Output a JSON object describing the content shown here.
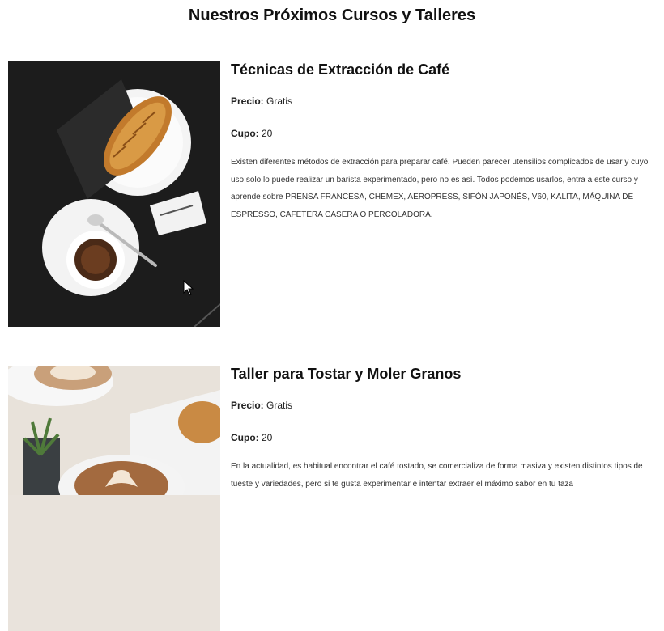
{
  "page": {
    "title": "Nuestros Próximos Cursos y Talleres"
  },
  "courses": [
    {
      "image_icon": "croissant-coffee-photo",
      "title": "Técnicas de Extracción de Café",
      "price_label": "Precio:",
      "price_value": "Gratis",
      "capacity_label": "Cupo:",
      "capacity_value": "20",
      "description": "Existen diferentes métodos de extracción para preparar café. Pueden parecer utensilios complicados de usar y cuyo uso solo lo puede realizar un barista experimentado, pero no es así. Todos podemos usarlos, entra a este curso y aprende sobre PRENSA FRANCESA, CHEMEX, AEROPRESS, SIFÓN JAPONÉS, V60, KALITA, MÁQUINA DE ESPRESSO, CAFETERA CASERA O PERCOLADORA."
    },
    {
      "image_icon": "latte-art-photo",
      "title": "Taller para Tostar y Moler Granos",
      "price_label": "Precio:",
      "price_value": "Gratis",
      "capacity_label": "Cupo:",
      "capacity_value": "20",
      "description": "En la actualidad, es habitual encontrar el café tostado, se comercializa de forma masiva y existen distintos tipos de tueste y variedades, pero si te gusta experimentar e intentar extraer el máximo sabor en tu taza"
    }
  ],
  "colors": {
    "text": "#111111",
    "divider": "#e2e2e2",
    "photo_dark": "#1e1e1e"
  }
}
